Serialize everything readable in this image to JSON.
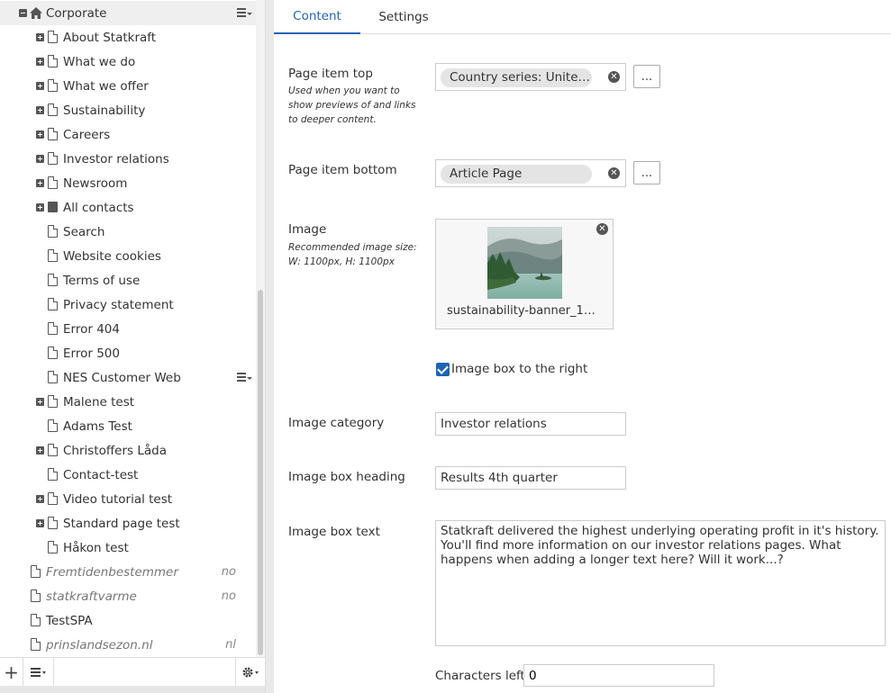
{
  "tree": {
    "root": {
      "label": "Corporate"
    },
    "items": [
      {
        "label": "About Statkraft",
        "expander": "plus",
        "icon": "page"
      },
      {
        "label": "What we do",
        "expander": "plus",
        "icon": "page"
      },
      {
        "label": "What we offer",
        "expander": "plus",
        "icon": "page"
      },
      {
        "label": "Sustainability",
        "expander": "plus",
        "icon": "page"
      },
      {
        "label": "Careers",
        "expander": "plus",
        "icon": "page"
      },
      {
        "label": "Investor relations",
        "expander": "plus",
        "icon": "page"
      },
      {
        "label": "Newsroom",
        "expander": "plus",
        "icon": "page"
      },
      {
        "label": "All contacts",
        "expander": "plus",
        "icon": "folder"
      },
      {
        "label": "Search",
        "expander": "none",
        "icon": "page"
      },
      {
        "label": "Website cookies",
        "expander": "none",
        "icon": "page"
      },
      {
        "label": "Terms of use",
        "expander": "none",
        "icon": "page"
      },
      {
        "label": "Privacy statement",
        "expander": "none",
        "icon": "page"
      },
      {
        "label": "Error 404",
        "expander": "none",
        "icon": "page"
      },
      {
        "label": "Error 500",
        "expander": "none",
        "icon": "page"
      },
      {
        "label": "NES Customer Web",
        "expander": "none",
        "icon": "page",
        "menu": true
      },
      {
        "label": "Malene test",
        "expander": "plus",
        "icon": "page"
      },
      {
        "label": "Adams Test",
        "expander": "none",
        "icon": "page"
      },
      {
        "label": "Christoffers Låda",
        "expander": "plus",
        "icon": "page"
      },
      {
        "label": "Contact-test",
        "expander": "none",
        "icon": "page"
      },
      {
        "label": "Video tutorial test",
        "expander": "plus",
        "icon": "page"
      },
      {
        "label": "Standard page test",
        "expander": "plus",
        "icon": "page"
      },
      {
        "label": "Håkon test",
        "expander": "none",
        "icon": "page"
      }
    ],
    "sites": [
      {
        "label": "Fremtidenbestemmer",
        "lang": "no",
        "italic": true
      },
      {
        "label": "statkraftvarme",
        "lang": "no",
        "italic": true
      },
      {
        "label": "TestSPA",
        "lang": "",
        "italic": false
      },
      {
        "label": "prinslandsezon.nl",
        "lang": "nl",
        "italic": true
      }
    ],
    "toolbar": {
      "add_glyph": "+"
    }
  },
  "editor": {
    "tabs": [
      {
        "label": "Content",
        "active": true
      },
      {
        "label": "Settings",
        "active": false
      }
    ],
    "page_item_top": {
      "label": "Page item top",
      "help": "Used when you want to show previews of and links to deeper content.",
      "value": "Country series: United ...",
      "browse": "..."
    },
    "page_item_bottom": {
      "label": "Page item bottom",
      "value": "Article Page",
      "browse": "..."
    },
    "image": {
      "label": "Image",
      "help": "Recommended image size: W: 1100px, H: 1100px",
      "filename": "sustainability-banner_110..."
    },
    "image_box_right": {
      "label": "Image box to the right",
      "checked": true
    },
    "image_category": {
      "label": "Image category",
      "value": "Investor relations"
    },
    "image_box_heading": {
      "label": "Image box heading",
      "value": "Results 4th quarter"
    },
    "image_box_text": {
      "label": "Image box text",
      "value": "Statkraft delivered the highest underlying operating profit in it's history. You'll find more information on our investor relations pages. What happens when adding a longer text here? Will it work...?"
    },
    "characters_left": {
      "label": "Characters left:",
      "value": "0"
    },
    "colors": {
      "accent": "#1e64b4"
    }
  }
}
